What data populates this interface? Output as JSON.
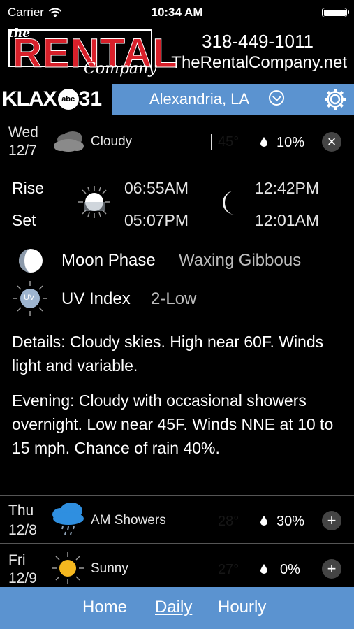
{
  "status": {
    "carrier": "Carrier",
    "time": "10:34 AM"
  },
  "banner": {
    "logo_the": "the",
    "logo_rental": "RENTAL",
    "logo_company": "Company",
    "phone": "318-449-1011",
    "website": "TheRentalCompany.net"
  },
  "station": {
    "call": "KLAX",
    "network": "abc",
    "channel": "31"
  },
  "location": {
    "name": "Alexandria, LA"
  },
  "days": [
    {
      "day": "Wed",
      "date": "12/7",
      "icon": "cloudy-icon",
      "condition": "Cloudy",
      "temps": "45°",
      "precip": "10%",
      "toggle": "×",
      "expanded": true
    },
    {
      "day": "Thu",
      "date": "12/8",
      "icon": "rain-cloud-icon",
      "condition": "AM Showers",
      "temps": "28°",
      "precip": "30%",
      "toggle": "+"
    },
    {
      "day": "Fri",
      "date": "12/9",
      "icon": "sun-icon",
      "condition": "Sunny",
      "temps": "27°",
      "precip": "0%",
      "toggle": "+"
    }
  ],
  "details": {
    "rise_label": "Rise",
    "set_label": "Set",
    "sunrise": "06:55AM",
    "sunset": "05:07PM",
    "moonrise": "12:42PM",
    "moonset": "12:01AM",
    "moon_phase_label": "Moon Phase",
    "moon_phase_value": "Waxing Gibbous",
    "uv_label": "UV Index",
    "uv_value": "2-Low",
    "uv_icon_text": "UV",
    "day_text": "Details: Cloudy skies. High near 60F. Winds light and variable.",
    "evening_text": "Evening: Cloudy with occasional showers overnight. Low near 45F. Winds NNE at 10 to 15 mph. Chance of rain 40%."
  },
  "nav": {
    "home": "Home",
    "daily": "Daily",
    "hourly": "Hourly"
  },
  "colors": {
    "accent_blue": "#5b93d0",
    "logo_red": "#d8202a",
    "background": "#000000"
  }
}
